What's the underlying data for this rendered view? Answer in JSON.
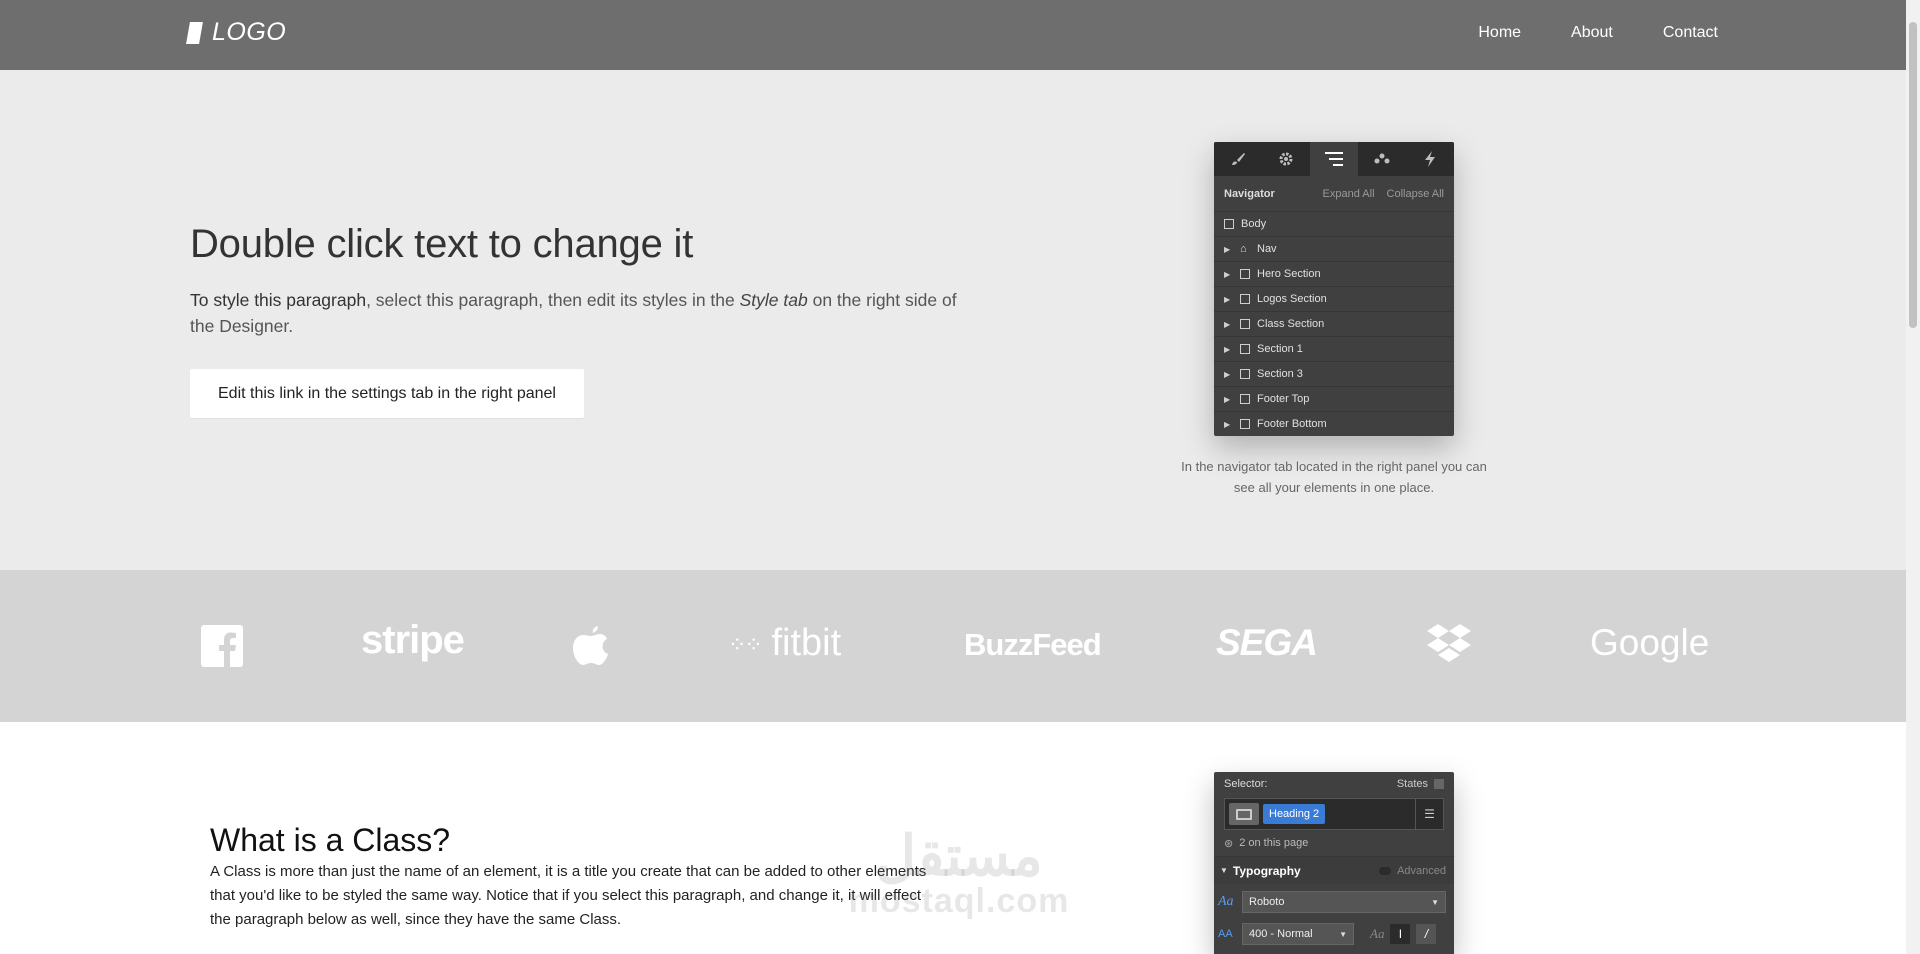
{
  "nav": {
    "logo_text": "LOGO",
    "links": [
      "Home",
      "About",
      "Contact"
    ]
  },
  "hero": {
    "title": "Double click text to change it",
    "paragraph": {
      "lead": "To style this paragraph",
      "mid": ", select this paragraph, then edit its styles in the ",
      "italic": "Style tab",
      "tail": " on the right side of the Designer."
    },
    "button_label": "Edit this link in the settings tab in the right panel",
    "navigator": {
      "tab_icons": [
        "brush-icon",
        "gear-icon",
        "navigator-icon",
        "drops-icon",
        "bolt-icon"
      ],
      "title": "Navigator",
      "expand_all": "Expand All",
      "collapse_all": "Collapse All",
      "body_label": "Body",
      "items": [
        "Nav",
        "Hero Section",
        "Logos Section",
        "Class Section",
        "Section 1",
        "Section 3",
        "Footer Top",
        "Footer Bottom"
      ]
    },
    "caption": "In the navigator tab located in the right panel you can see all your elements in one place."
  },
  "logos": [
    {
      "name": "facebook-logo",
      "text": "f"
    },
    {
      "name": "stripe-logo",
      "text": "stripe"
    },
    {
      "name": "apple-logo",
      "text": ""
    },
    {
      "name": "fitbit-logo",
      "text": "fitbit"
    },
    {
      "name": "buzzfeed-logo",
      "text": "BuzzFeed"
    },
    {
      "name": "sega-logo",
      "text": "SEGA"
    },
    {
      "name": "dropbox-logo",
      "text": ""
    },
    {
      "name": "google-logo",
      "text": "Google"
    }
  ],
  "class_section": {
    "title": "What is a Class?",
    "paragraph": "A Class is more than just the name of an element, it is a title you create that can be added to other elements that you'd like to be styled the same way. Notice that if you select this paragraph, and change it, it will effect the paragraph below as well, since they have the same Class.",
    "selector": {
      "label": "Selector:",
      "states": "States",
      "tag": "Heading 2",
      "count": "2 on this page",
      "typography": "Typography",
      "advanced": "Advanced",
      "font": "Roboto",
      "weight": "400 - Normal",
      "style_aa": "Aa",
      "style_i": "I"
    }
  },
  "watermark": {
    "arabic": "مستقل",
    "latin": "mostaql.com"
  },
  "colors": {
    "nav_bg": "#6e6e6e",
    "hero_bg": "#ebebeb",
    "logo_strip_bg": "#d4d4d4",
    "panel_bg": "#404040",
    "accent": "#3a7bd5"
  }
}
